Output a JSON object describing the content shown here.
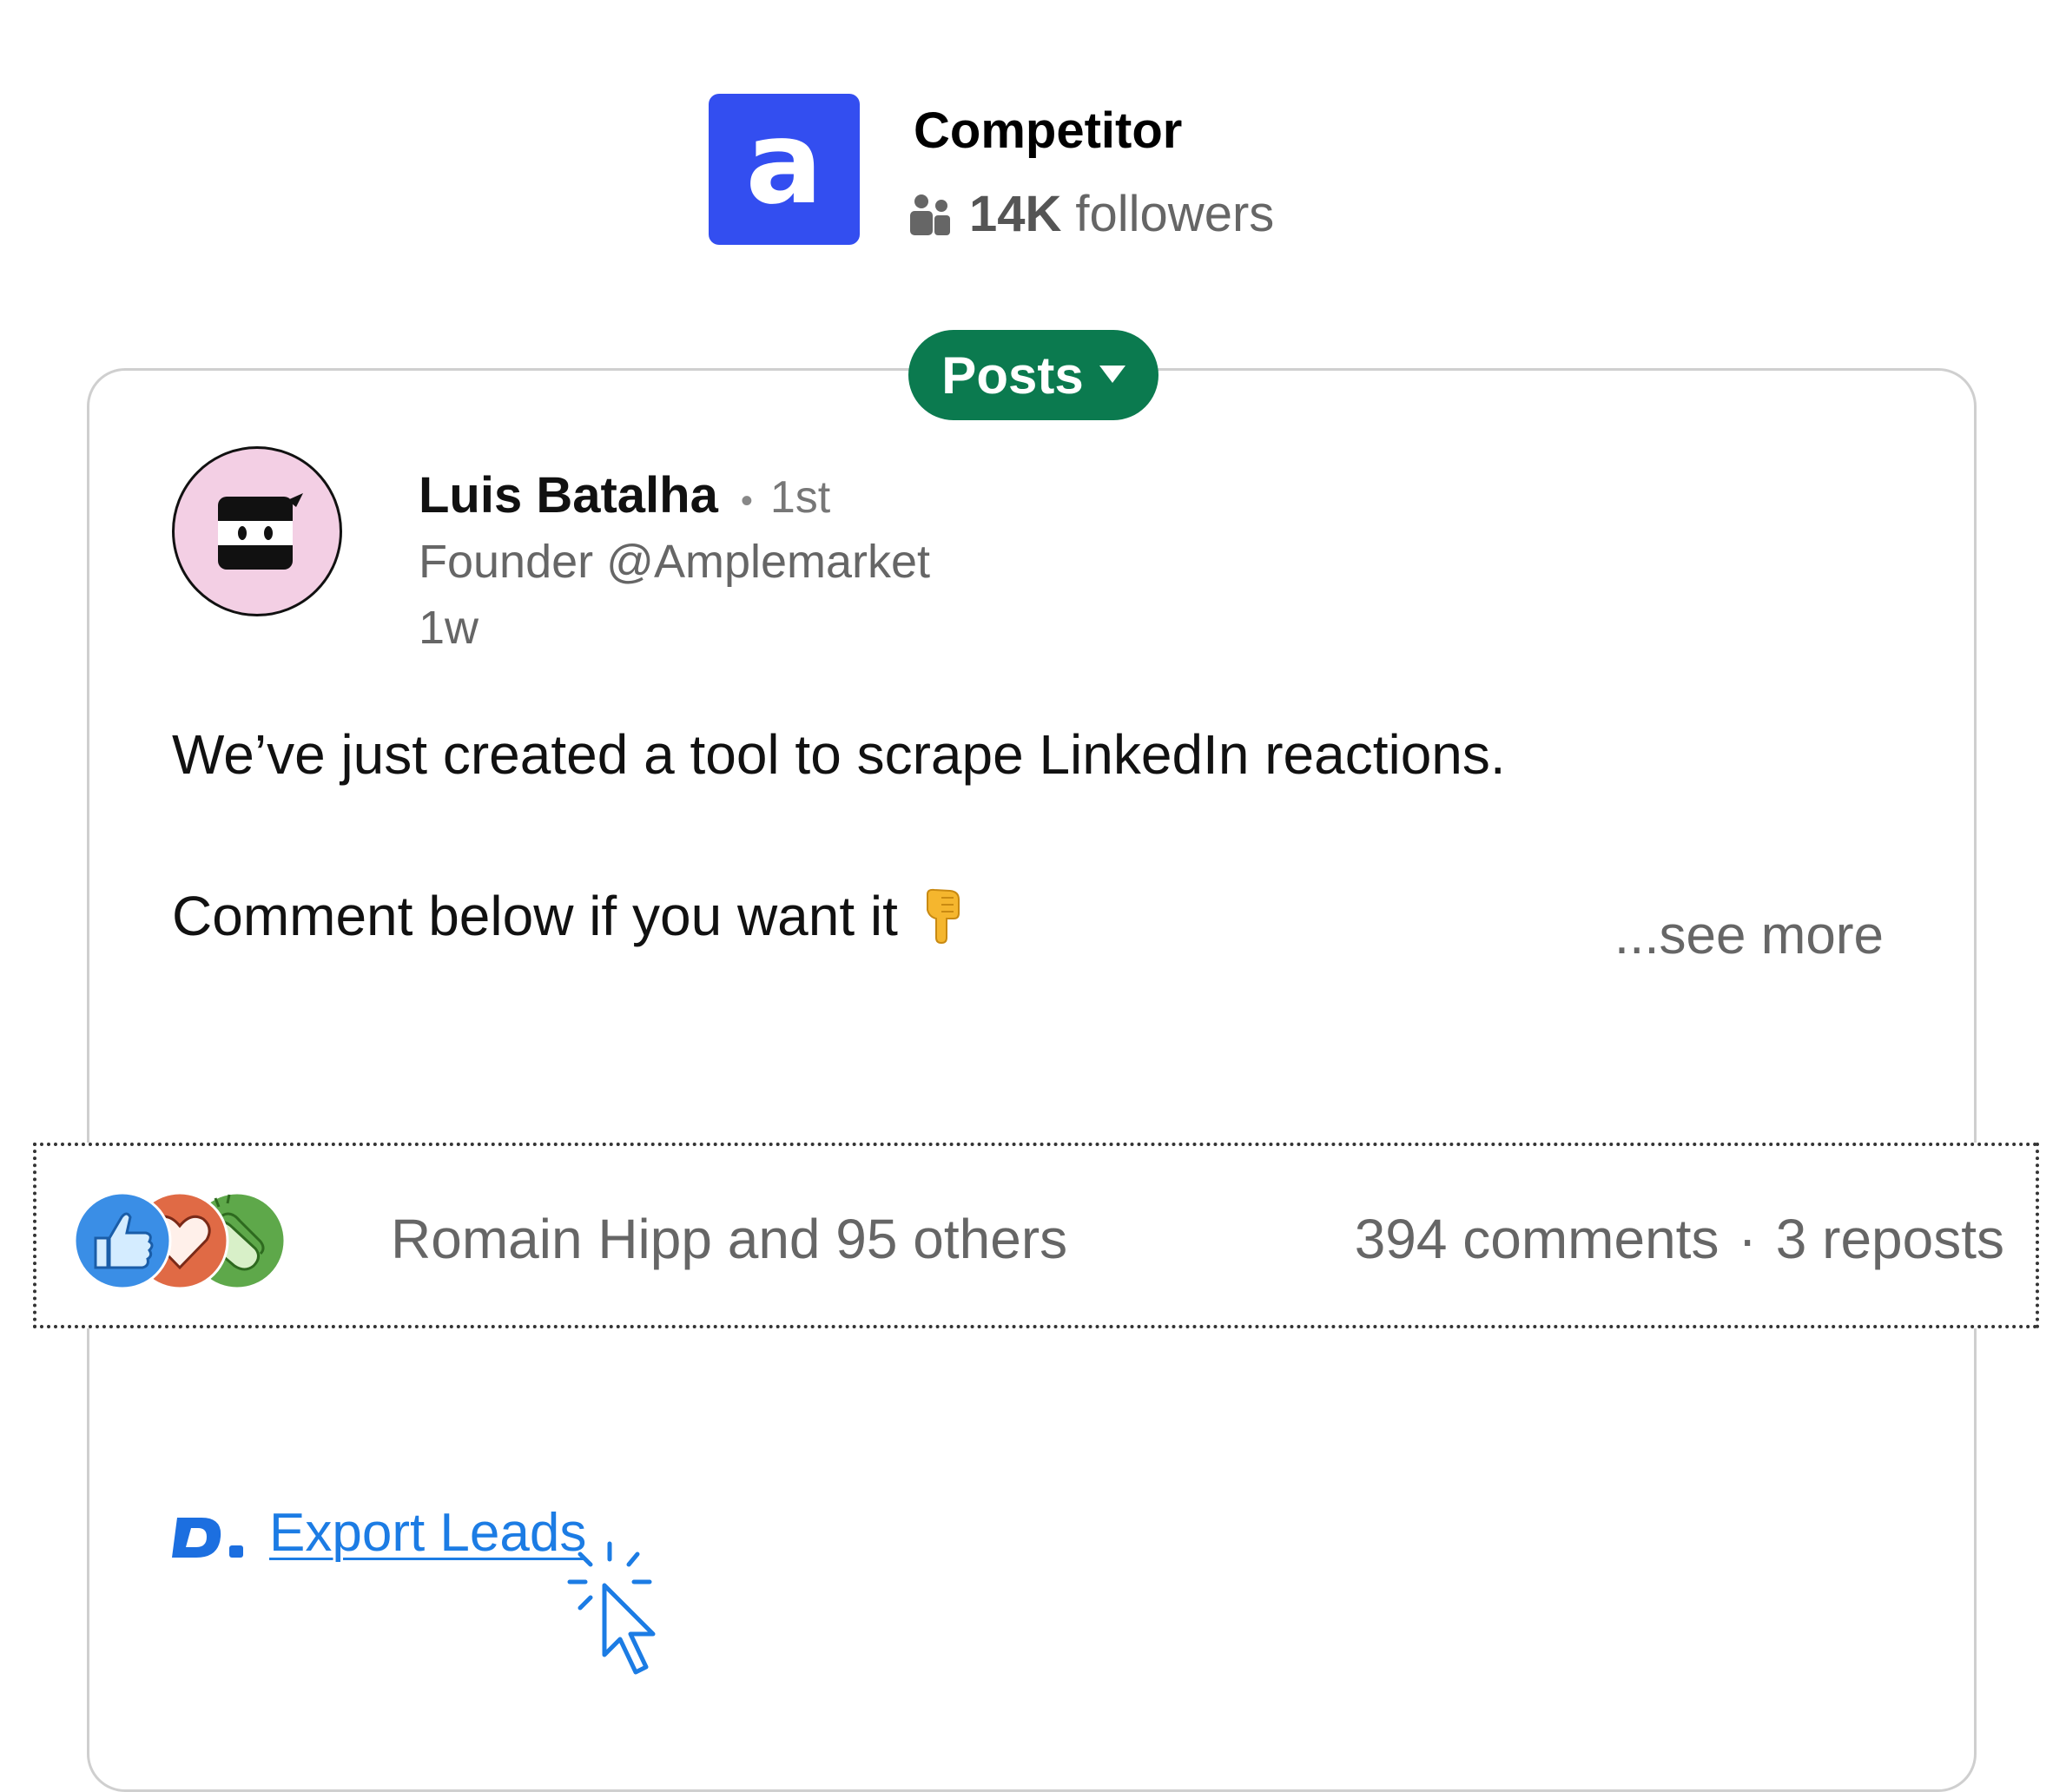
{
  "company": {
    "logo_letter": "a",
    "name": "Competitor",
    "followers_count": "14K",
    "followers_label": "followers",
    "logo_color": "#334ef0"
  },
  "feed": {
    "filter_label": "Posts",
    "filter_color": "#0b7a4f"
  },
  "post": {
    "author_name": "Luis Batalha",
    "separator": "•",
    "degree": "1st",
    "author_title": "Founder @Amplemarket",
    "age": "1w",
    "line1": "We’ve just created a tool to scrape LinkedIn reactions.",
    "line2": "Comment below if you want it",
    "see_more": "...see more",
    "reactions": {
      "icons": [
        "like-icon",
        "love-icon",
        "celebrate-icon"
      ],
      "reactors_text": "Romain Hipp and 95 others",
      "comments_text": "394 comments",
      "separator": "·",
      "reposts_text": "3 reposts"
    }
  },
  "export": {
    "link_label": "Export Leads",
    "link_color": "#1c7ce4"
  }
}
